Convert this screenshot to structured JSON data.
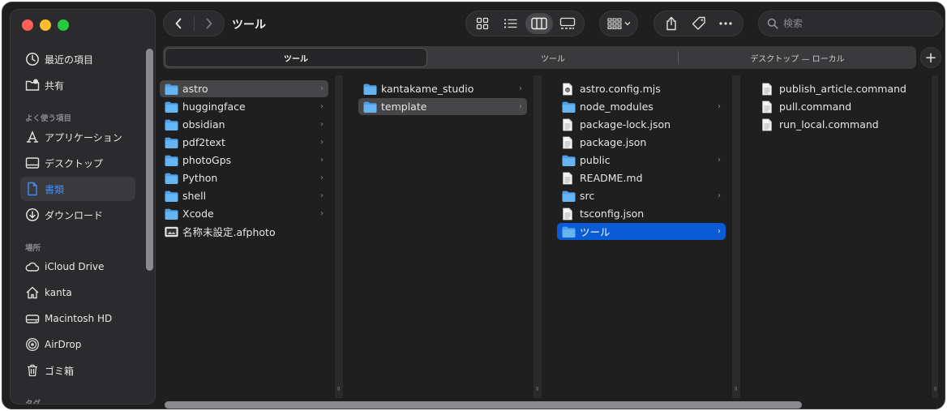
{
  "window": {
    "title": "ツール",
    "search_placeholder": "検索"
  },
  "tabs": [
    {
      "label": "ツール",
      "active": true
    },
    {
      "label": "ツール",
      "active": false
    },
    {
      "label": "デスクトップ — ローカル",
      "active": false
    }
  ],
  "sidebar": {
    "favorites": [
      {
        "label": "最近の項目",
        "icon": "clock-icon"
      },
      {
        "label": "共有",
        "icon": "shared-folder-icon"
      }
    ],
    "section_often": "よく使う項目",
    "often": [
      {
        "label": "アプリケーション",
        "icon": "applications-icon"
      },
      {
        "label": "デスクトップ",
        "icon": "desktop-icon"
      },
      {
        "label": "書類",
        "icon": "document-icon",
        "selected": true
      },
      {
        "label": "ダウンロード",
        "icon": "download-icon"
      }
    ],
    "section_locations": "場所",
    "locations": [
      {
        "label": "iCloud Drive",
        "icon": "cloud-icon"
      },
      {
        "label": "kanta",
        "icon": "home-icon"
      },
      {
        "label": "Macintosh HD",
        "icon": "disk-icon"
      },
      {
        "label": "AirDrop",
        "icon": "airdrop-icon"
      },
      {
        "label": "ゴミ箱",
        "icon": "trash-icon"
      }
    ],
    "section_tags": "タグ"
  },
  "columns": [
    {
      "items": [
        {
          "name": "astro",
          "kind": "folder",
          "selected": "inactive"
        },
        {
          "name": "huggingface",
          "kind": "folder"
        },
        {
          "name": "obsidian",
          "kind": "folder"
        },
        {
          "name": "pdf2text",
          "kind": "folder"
        },
        {
          "name": "photoGps",
          "kind": "folder"
        },
        {
          "name": "Python",
          "kind": "folder"
        },
        {
          "name": "shell",
          "kind": "folder"
        },
        {
          "name": "Xcode",
          "kind": "folder"
        },
        {
          "name": "名称未設定.afphoto",
          "kind": "image"
        }
      ]
    },
    {
      "items": [
        {
          "name": "kantakame_studio",
          "kind": "folder"
        },
        {
          "name": "template",
          "kind": "folder",
          "selected": "inactive"
        }
      ]
    },
    {
      "items": [
        {
          "name": "astro.config.mjs",
          "kind": "script"
        },
        {
          "name": "node_modules",
          "kind": "folder"
        },
        {
          "name": "package-lock.json",
          "kind": "file"
        },
        {
          "name": "package.json",
          "kind": "file"
        },
        {
          "name": "public",
          "kind": "folder"
        },
        {
          "name": "README.md",
          "kind": "file"
        },
        {
          "name": "src",
          "kind": "folder"
        },
        {
          "name": "tsconfig.json",
          "kind": "file"
        },
        {
          "name": "ツール",
          "kind": "folder",
          "selected": "active"
        }
      ]
    },
    {
      "items": [
        {
          "name": "publish_article.command",
          "kind": "file"
        },
        {
          "name": "pull.command",
          "kind": "file"
        },
        {
          "name": "run_local.command",
          "kind": "file"
        }
      ]
    }
  ],
  "colors": {
    "accent": "#0a5bd6",
    "folder": "#5aa9ef",
    "sidebar_selected_text": "#3f8cff"
  }
}
